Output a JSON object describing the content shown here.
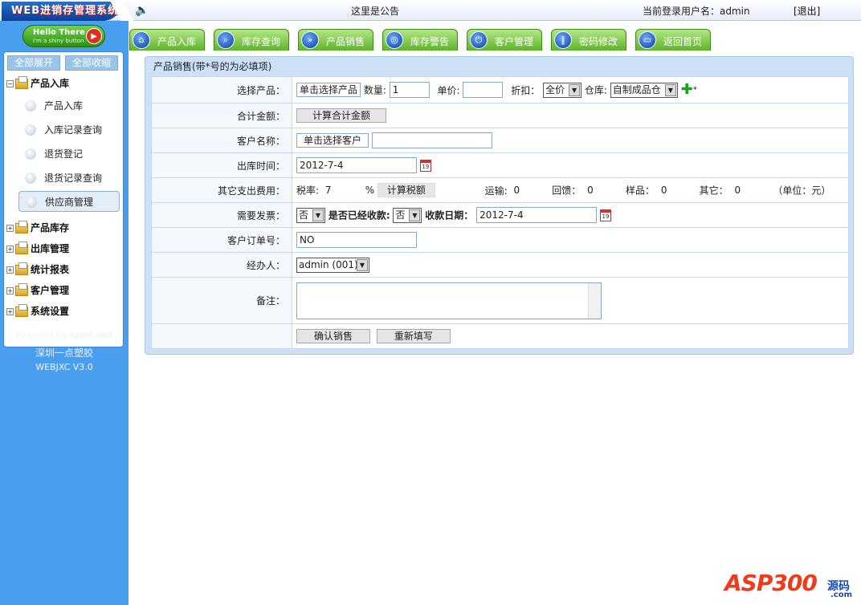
{
  "header": {
    "logo": "WEB进销存管理系统",
    "notice": "这里是公告",
    "user_label": "当前登录用户名：admin",
    "logout": "[退出]"
  },
  "sidebar": {
    "hello_title": "Hello There",
    "hello_sub": "I'm a shiny button",
    "expand_all": "全部展开",
    "collapse_all": "全部收缩",
    "groups": [
      {
        "label": "产品入库",
        "state": "−"
      },
      {
        "label": "产品库存",
        "state": "+"
      },
      {
        "label": "出库管理",
        "state": "+"
      },
      {
        "label": "统计报表",
        "state": "+"
      },
      {
        "label": "客户管理",
        "state": "+"
      },
      {
        "label": "系统设置",
        "state": "+"
      }
    ],
    "subitems": [
      "产品入库",
      "入库记录查询",
      "退货登记",
      "退货记录查询",
      "供应商管理"
    ],
    "powered_prefix": "Powered by ",
    "powered_brand": "szed.net",
    "company": "深圳一点塑胶",
    "version": "WEBJXC V3.0"
  },
  "tabs": [
    "产品入库",
    "库存查询",
    "产品销售",
    "库存警告",
    "客户管理",
    "密码修改",
    "返回首页"
  ],
  "form": {
    "title": "产品销售(带*号的为必填项)",
    "rows": {
      "product_label": "选择产品：",
      "select_product_btn": "单击选择产品",
      "qty_label": "数量:",
      "qty_value": "1",
      "price_label": "单价:",
      "price_value": "",
      "discount_label": "折扣：",
      "discount_value": "全价",
      "warehouse_label": "仓库:",
      "warehouse_value": "自制成品仓",
      "required_mark": "*",
      "total_label": "合计金额：",
      "calc_total_btn": "计算合计金额",
      "customer_label": "客户名称：",
      "select_customer_btn": "单击选择客户",
      "customer_value": "",
      "date_label": "出库时间：",
      "date_value": "2012-7-4",
      "other_label": "其它支出费用：",
      "tax_label": "税率:",
      "tax_value": "7",
      "percent": "%",
      "calc_tax_btn": "计算税额",
      "tax_amount": "",
      "freight_label": "运输:",
      "freight_value": "0",
      "rebate_label": "回馈：",
      "rebate_value": "0",
      "sample_label": "样品：",
      "sample_value": "0",
      "others_label": "其它：",
      "others_value": "0",
      "unit": "（单位：元）",
      "invoice_label": "需要发票：",
      "invoice_value": "否",
      "paid_label": "是否已经收款:",
      "paid_value": "否",
      "pay_date_label": "收款日期：",
      "pay_date_value": "2012-7-4",
      "order_label": "客户订单号：",
      "order_value": "NO",
      "handler_label": "经办人：",
      "handler_value": "admin (001)",
      "remark_label": "备注：",
      "confirm_btn": "确认销售",
      "reset_btn": "重新填写"
    }
  },
  "watermark": {
    "asp": "ASP300",
    "ym": "源码",
    "com": ".com"
  },
  "colors": {
    "sidebar": "#4a9ef0",
    "tab_green": "#5cb528",
    "panel": "#cde0f4"
  }
}
